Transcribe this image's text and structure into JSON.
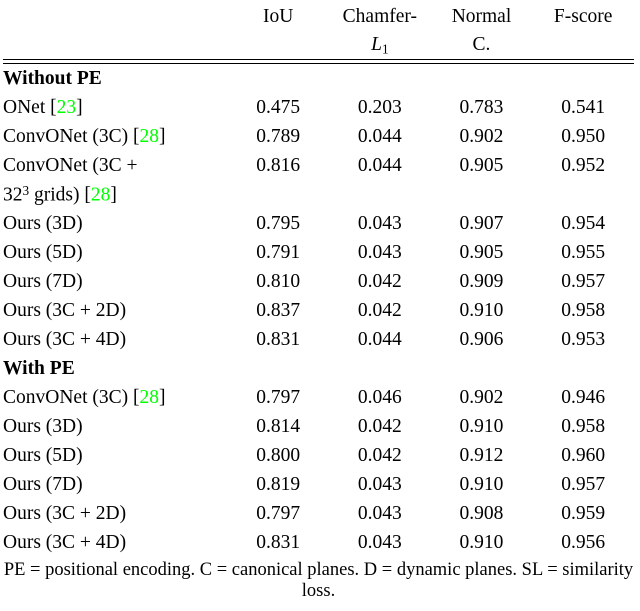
{
  "table": {
    "columns": [
      {
        "label": "",
        "name": "method"
      },
      {
        "label": "IoU",
        "name": "iou"
      },
      {
        "label": "Chamfer-",
        "label_line2": "L",
        "label_line2_sub": "1",
        "name": "chamfer-l1"
      },
      {
        "label": "Normal",
        "label_line2": "C.",
        "name": "normal-consistency"
      },
      {
        "label": "F-score",
        "name": "f-score"
      }
    ],
    "sections": [
      {
        "heading": "Without PE",
        "rows": [
          {
            "label": "ONet ",
            "cite": "23",
            "label_tail": "",
            "values": [
              "0.475",
              "0.203",
              "0.783",
              "0.541"
            ],
            "bold": [
              false,
              false,
              false,
              false
            ]
          },
          {
            "label": "ConvONet (3C) ",
            "cite": "28",
            "label_tail": "",
            "values": [
              "0.789",
              "0.044",
              "0.902",
              "0.950"
            ],
            "bold": [
              false,
              false,
              false,
              false
            ]
          },
          {
            "label": "ConvONet (3C +",
            "label_line2_pre": "32",
            "label_line2_sup": "3",
            "label_line2_mid": " grids) ",
            "cite": "28",
            "label_tail": "",
            "values": [
              "0.816",
              "0.044",
              "0.905",
              "0.952"
            ],
            "bold": [
              false,
              false,
              false,
              false
            ],
            "two_line": true
          },
          {
            "label": "Ours (3D)",
            "values": [
              "0.795",
              "0.043",
              "0.907",
              "0.954"
            ],
            "bold": [
              false,
              false,
              false,
              false
            ]
          },
          {
            "label": "Ours (5D)",
            "values": [
              "0.791",
              "0.043",
              "0.905",
              "0.955"
            ],
            "bold": [
              false,
              false,
              false,
              false
            ]
          },
          {
            "label": "Ours (7D)",
            "values": [
              "0.810",
              "0.042",
              "0.909",
              "0.957"
            ],
            "bold": [
              false,
              true,
              false,
              false
            ]
          },
          {
            "label": "Ours (3C + 2D)",
            "values": [
              "0.837",
              "0.042",
              "0.910",
              "0.958"
            ],
            "bold": [
              true,
              true,
              false,
              false
            ]
          },
          {
            "label": "Ours (3C + 4D)",
            "values": [
              "0.831",
              "0.044",
              "0.906",
              "0.953"
            ],
            "bold": [
              false,
              false,
              false,
              false
            ]
          }
        ]
      },
      {
        "heading": "With PE",
        "rows": [
          {
            "label": "ConvONet (3C) ",
            "cite": "28",
            "label_tail": "",
            "values": [
              "0.797",
              "0.046",
              "0.902",
              "0.946"
            ],
            "bold": [
              false,
              false,
              false,
              false
            ]
          },
          {
            "label": "Ours (3D)",
            "values": [
              "0.814",
              "0.042",
              "0.910",
              "0.958"
            ],
            "bold": [
              false,
              true,
              false,
              false
            ]
          },
          {
            "label": "Ours (5D)",
            "values": [
              "0.800",
              "0.042",
              "0.912",
              "0.960"
            ],
            "bold": [
              false,
              true,
              true,
              true
            ]
          },
          {
            "label": "Ours (7D)",
            "values": [
              "0.819",
              "0.043",
              "0.910",
              "0.957"
            ],
            "bold": [
              false,
              false,
              false,
              false
            ]
          },
          {
            "label": "Ours (3C + 2D)",
            "values": [
              "0.797",
              "0.043",
              "0.908",
              "0.959"
            ],
            "bold": [
              false,
              false,
              false,
              false
            ]
          },
          {
            "label": "Ours (3C + 4D)",
            "values": [
              "0.831",
              "0.043",
              "0.910",
              "0.956"
            ],
            "bold": [
              false,
              false,
              false,
              false
            ]
          }
        ]
      }
    ]
  },
  "caption": {
    "text": "PE = positional encoding. C = canonical planes. D = dynamic planes. SL = similarity loss."
  },
  "colors": {
    "citation": "#00ff00",
    "rule": "#000000",
    "text": "#000000"
  }
}
